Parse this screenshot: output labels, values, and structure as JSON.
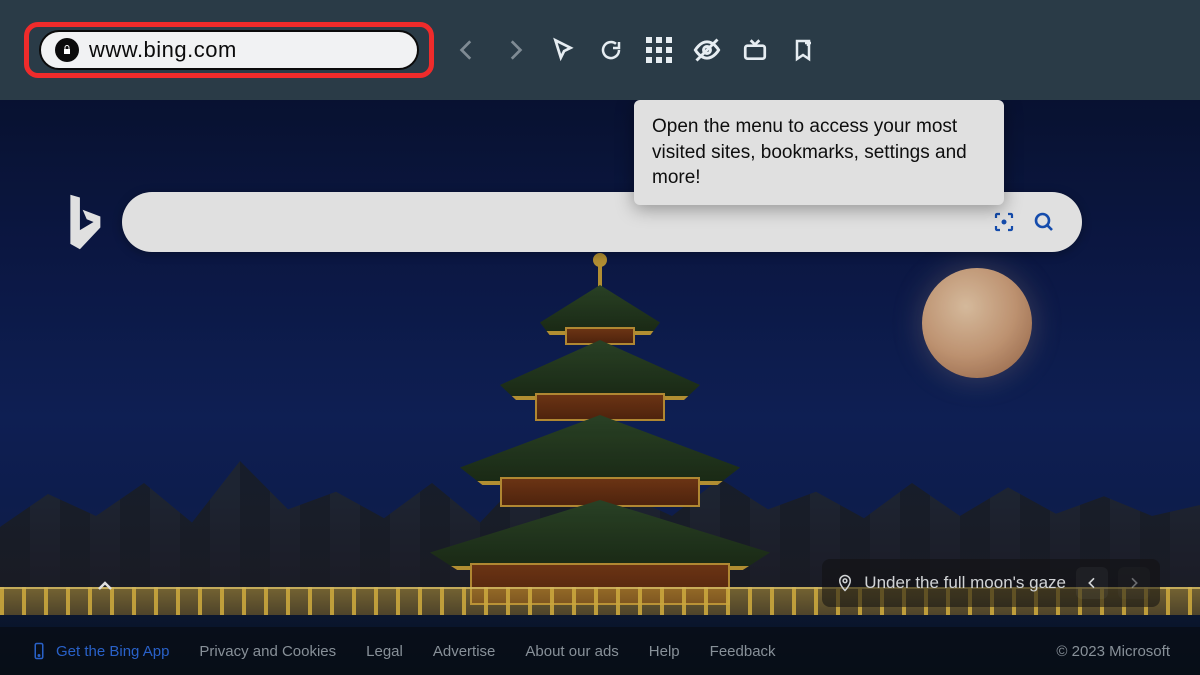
{
  "browser": {
    "url": "www.bing.com",
    "tooltip": "Open the menu to access your most visited sites, bookmarks, settings and more!"
  },
  "search": {
    "placeholder": ""
  },
  "caption": {
    "icon": "location",
    "text": "Under the full moon's gaze"
  },
  "footer": {
    "app_link": "Get the Bing App",
    "links": [
      "Privacy and Cookies",
      "Legal",
      "Advertise",
      "About our ads",
      "Help",
      "Feedback"
    ],
    "copyright": "© 2023 Microsoft"
  }
}
